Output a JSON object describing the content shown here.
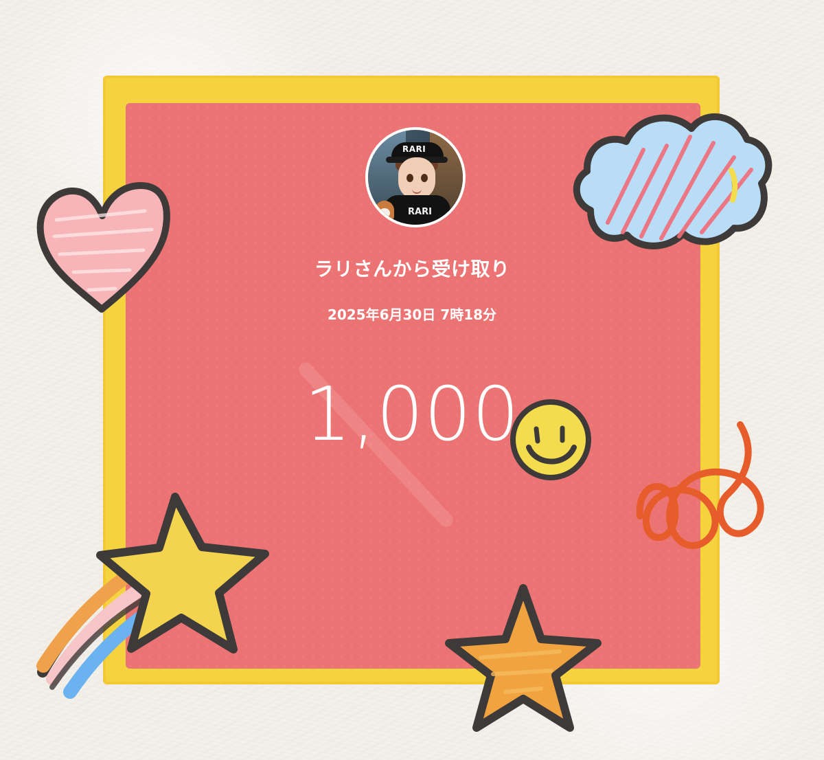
{
  "card": {
    "title": "ラリさんから受け取り",
    "datetime": "2025年6月30日 7時18分",
    "amount": "1,000"
  },
  "avatar": {
    "cap_text": "RARI",
    "hoodie_text": "RARI"
  },
  "colors": {
    "background": "#f3f0ea",
    "frame_yellow": "#f5d33f",
    "card_red": "#ec7373",
    "text_white": "#ffffff",
    "heart_pink": "#f7b5b7",
    "cloud_blue": "#b9ddf6",
    "smiley_yellow": "#f3dc4d",
    "star_yellow": "#f4d44e",
    "star_orange": "#f1a33f",
    "swirl_orange": "#e65c2a",
    "rainbow_orange": "#f0a14b",
    "rainbow_pink": "#f6c5c8",
    "rainbow_blue": "#6bb2f0"
  },
  "icons": {
    "heart": "heart-icon",
    "cloud": "cloud-icon",
    "smiley": "smiley-face-icon",
    "swirl": "swirl-icon",
    "shooting_star": "shooting-star-icon",
    "star": "star-icon"
  }
}
